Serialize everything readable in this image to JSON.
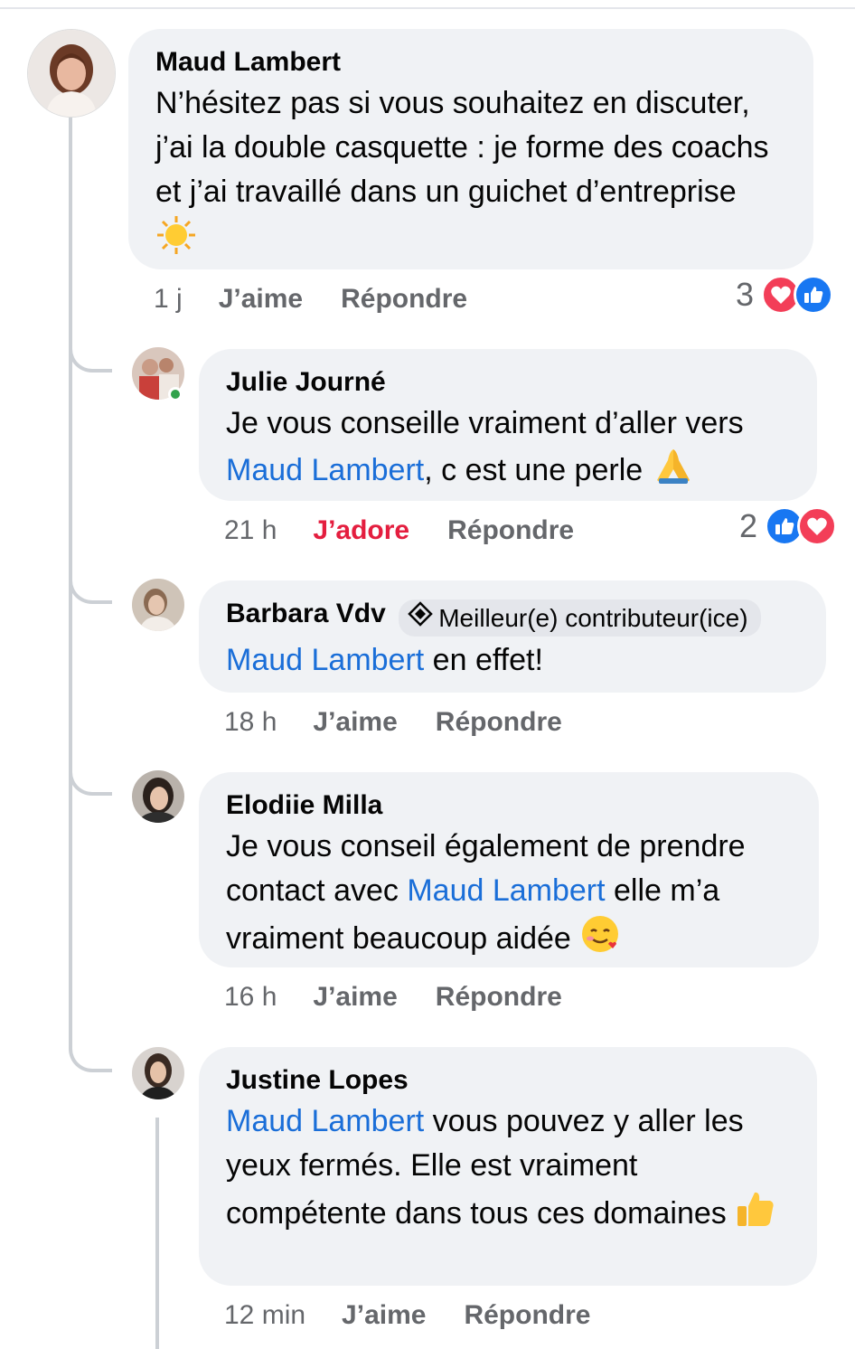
{
  "comments": [
    {
      "author": "Maud Lambert",
      "text": "N’hésitez pas si vous souhaitez en discuter, j’ai la double casquette : je forme des coachs et j’ai travaillé dans un guichet d’entreprise",
      "emoji": "sun-emoji",
      "time": "1 j",
      "like_label": "J’aime",
      "reply_label": "Répondre",
      "reaction_count": "3"
    },
    {
      "author": "Julie Journé",
      "text_before": "Je vous conseille vraiment d’aller vers",
      "mention": "Maud Lambert",
      "text_after": ", c est une perle",
      "emoji": "folded-hands-emoji",
      "time": "21 h",
      "like_label": "J’adore",
      "reply_label": "Répondre",
      "reaction_count": "2"
    },
    {
      "author": "Barbara Vdv",
      "badge": "Meilleur(e) contributeur(ice)",
      "mention": "Maud Lambert",
      "text_after": " en effet!",
      "time": "18 h",
      "like_label": "J’aime",
      "reply_label": "Répondre"
    },
    {
      "author": "Elodiie Milla",
      "text_before": "Je vous conseil également de prendre contact avec ",
      "mention": "Maud Lambert",
      "text_after": " elle m’a vraiment beaucoup aidée",
      "emoji": "smiling-face-with-hearts-emoji",
      "time": "16 h",
      "like_label": "J’aime",
      "reply_label": "Répondre"
    },
    {
      "author": "Justine Lopes",
      "mention": "Maud Lambert",
      "text_after": " vous pouvez y aller les yeux fermés. Elle est vraiment compétente dans tous ces domaines",
      "emoji": "thumbs-up-emoji",
      "time": "12 min",
      "like_label": "J’aime",
      "reply_label": "Répondre"
    }
  ],
  "colors": {
    "bubble": "#f0f2f5",
    "mention": "#1a6ed8",
    "meta": "#65676b",
    "love": "#e41e3f",
    "like_icon": "#1877f2",
    "heart_icon": "#f33e58",
    "online": "#31a24c"
  }
}
